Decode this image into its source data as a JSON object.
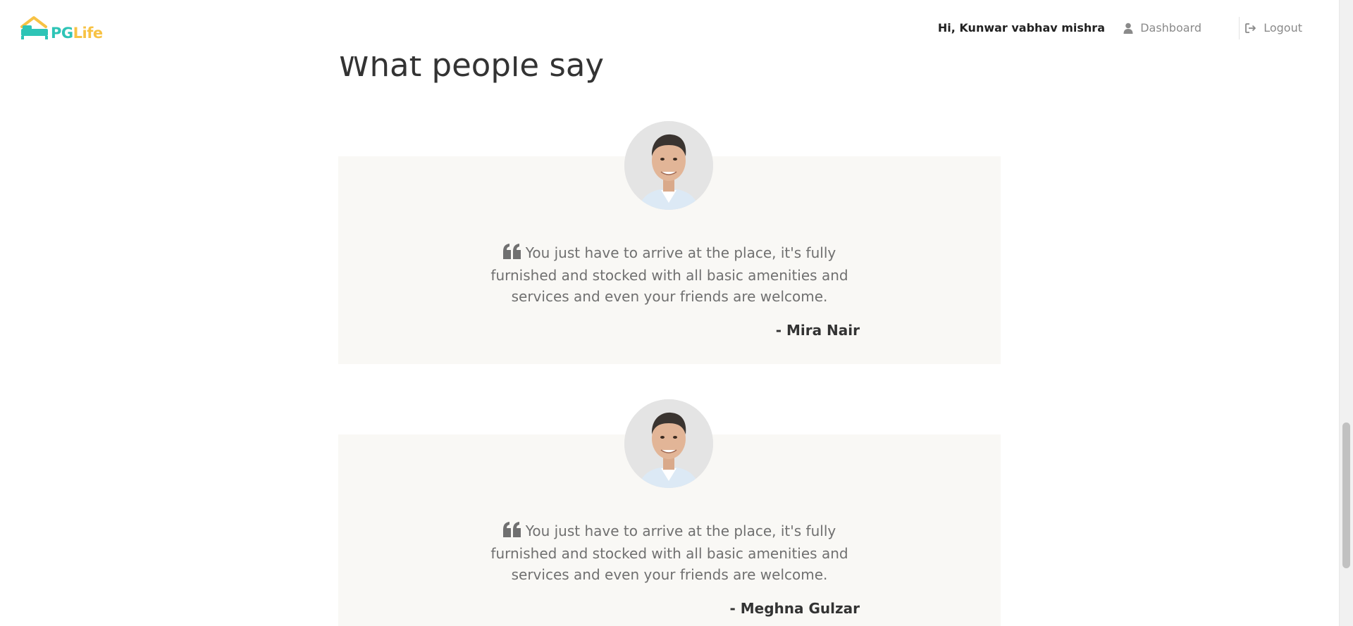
{
  "header": {
    "logo": {
      "pg": "PG",
      "life": "Life"
    },
    "greeting": "Hi, Kunwar vabhav mishra",
    "dashboard_label": "Dashboard",
    "logout_label": "Logout"
  },
  "section": {
    "title": "What people say"
  },
  "testimonials": [
    {
      "quote": "You just have to arrive at the place, it's fully furnished and stocked with all basic amenities and services and even your friends are welcome.",
      "author": "- Mira Nair"
    },
    {
      "quote": "You just have to arrive at the place, it's fully furnished and stocked with all basic amenities and services and even your friends are welcome.",
      "author": "- Meghna Gulzar"
    }
  ],
  "icons": {
    "logo": "house-bed-logo-icon",
    "dashboard": "user-icon",
    "logout": "sign-out-icon",
    "quote": "quote-left-icon"
  },
  "colors": {
    "brand_teal": "#2ec4b6",
    "brand_yellow": "#f7c244",
    "card_background": "#f9f8f5",
    "text_muted": "#707070"
  }
}
